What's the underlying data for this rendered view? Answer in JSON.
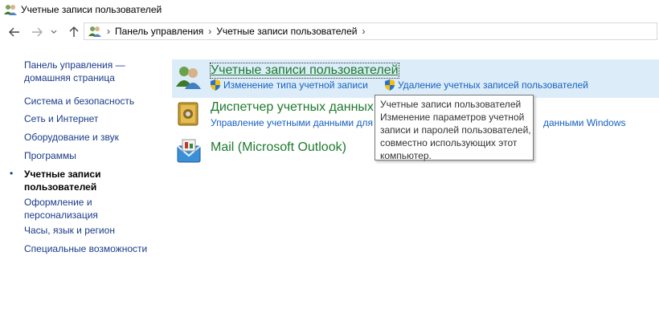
{
  "window": {
    "title": "Учетные записи пользователей"
  },
  "nav": {
    "back_icon": "arrow-left-icon",
    "forward_icon": "arrow-right-icon",
    "recent_icon": "chevron-down-icon",
    "up_icon": "arrow-up-icon"
  },
  "address": {
    "crumbs": [
      "Панель управления",
      "Учетные записи пользователей"
    ],
    "separator": "›"
  },
  "sidebar": {
    "home_line1": "Панель управления —",
    "home_line2": "домашняя страница",
    "items": [
      {
        "label": "Система и безопасность"
      },
      {
        "label": "Сеть и Интернет"
      },
      {
        "label": "Оборудование и звук"
      },
      {
        "label": "Программы"
      },
      {
        "label_line1": "Учетные записи",
        "label_line2": "пользователей",
        "current": true
      },
      {
        "label_line1": "Оформление и",
        "label_line2": "персонализация"
      },
      {
        "label": "Часы, язык и регион"
      },
      {
        "label": "Специальные возможности"
      }
    ],
    "bullet": "•"
  },
  "categories": [
    {
      "title": "Учетные записи пользователей",
      "icon": "users-icon",
      "links": [
        "Изменение типа учетной записи",
        "Удаление учетных записей пользователей"
      ]
    },
    {
      "title": "Диспетчер учетных данных",
      "icon": "credential-vault-icon",
      "link_left": "Управление учетными данными для",
      "link_right": "данными Windows"
    },
    {
      "title": "Mail (Microsoft Outlook)",
      "icon": "mail-icon"
    }
  ],
  "tooltip": {
    "lines": [
      "Учетные записи пользователей",
      "Изменение параметров учетной",
      "записи и паролей пользователей,",
      "совместно использующих этот",
      "компьютер."
    ]
  },
  "colors": {
    "link": "#1560c0",
    "category_title": "#1f7a2e",
    "highlight": "#dcedf9",
    "sidebar_link": "#1a3a8a"
  }
}
